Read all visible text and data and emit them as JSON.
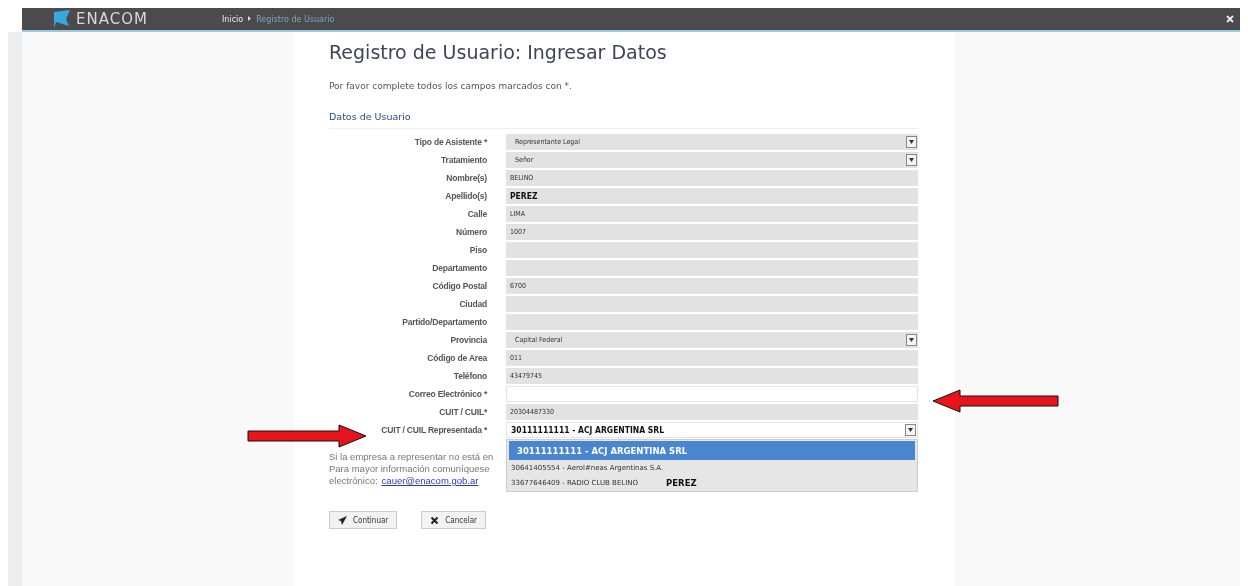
{
  "header": {
    "logo": "ENACOM",
    "breadcrumb": [
      {
        "label": "Inicio",
        "current": false
      },
      {
        "label": "Registro de Usuario",
        "current": true
      }
    ]
  },
  "title": "Registro de Usuario: Ingresar Datos",
  "intro": "Por favor complete todos los campos marcados con *.",
  "section": "Datos de Usuario",
  "fields": [
    {
      "label": "Tipo de Asistente *",
      "kind": "select",
      "value": "Representante Legal",
      "editable": false,
      "bold": false
    },
    {
      "label": "Tratamiento",
      "kind": "select",
      "value": "Señor",
      "editable": false,
      "bold": false
    },
    {
      "label": "Nombre(s)",
      "kind": "text",
      "value": "BELINO",
      "editable": false,
      "bold": false
    },
    {
      "label": "Apellido(s)",
      "kind": "text",
      "value": "PEREZ",
      "editable": false,
      "bold": true
    },
    {
      "label": "Calle",
      "kind": "text",
      "value": "LIMA",
      "editable": false,
      "bold": false
    },
    {
      "label": "Número",
      "kind": "text",
      "value": "1007",
      "editable": false,
      "bold": false
    },
    {
      "label": "Piso",
      "kind": "text",
      "editable": false
    },
    {
      "label": "Departamento",
      "kind": "text",
      "editable": false
    },
    {
      "label": "Código Postal",
      "kind": "text",
      "value": "6700",
      "editable": false,
      "bold": false
    },
    {
      "label": "Ciudad",
      "kind": "text",
      "editable": false
    },
    {
      "label": "Partido/Departamento",
      "kind": "text",
      "editable": false
    },
    {
      "label": "Provincia",
      "kind": "select",
      "value": "Capital Federal",
      "editable": false,
      "bold": false
    },
    {
      "label": "Código de Area",
      "kind": "text",
      "value": "011",
      "editable": false,
      "bold": false
    },
    {
      "label": "Teléfono",
      "kind": "text",
      "value": "43479745",
      "editable": false,
      "bold": false
    },
    {
      "label": "Correo Electrónico *",
      "kind": "text",
      "editable": true
    },
    {
      "label": "CUIT / CUIL*",
      "kind": "text",
      "value": "20304487330",
      "editable": false,
      "bold": false
    },
    {
      "label": "CUIT / CUIL Representada *",
      "kind": "dropdown",
      "value": "30111111111 - ACJ ARGENTINA SRL",
      "editable": true,
      "bold": true,
      "options": [
        {
          "label": "30111111111 - ACJ ARGENTINA SRL",
          "selected": true
        },
        {
          "label": "30641405554 - Aerol#neas Argentinas S.A.",
          "selected": false
        },
        {
          "label": "33677646409 - RADIO CLUB BELINO",
          "selected": false,
          "note": "PEREZ"
        }
      ]
    }
  ],
  "notice_lines": [
    "Si la empresa a representar no está en",
    "Para mayor información comuníquese"
  ],
  "notice_last": "electrónico:",
  "notice_link": "cauer@enacom.gob.ar",
  "buttons": [
    {
      "label": "Continuar",
      "kind": "send"
    },
    {
      "label": "Cancelar",
      "kind": "cancel"
    }
  ]
}
